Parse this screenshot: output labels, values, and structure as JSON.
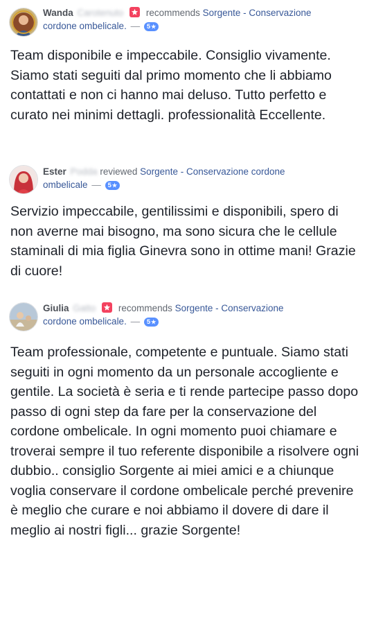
{
  "colors": {
    "link": "#385898",
    "badge": "#5890ff",
    "recommend": "#f3425f",
    "text": "#1d2129"
  },
  "reviews": [
    {
      "first_name": "Wanda",
      "last_name": "Carotenuto",
      "has_recommend_icon": true,
      "action": "recommends",
      "page": "Sorgente - Conservazione cordone ombelicale.",
      "separator": "—",
      "rating": "5",
      "rating_icon": "star-icon",
      "text": "Team disponibile e impeccabile. Consiglio vivamente. Siamo stati seguiti dal primo momento che li abbiamo contattati e non ci hanno mai deluso. Tutto perfetto e curato nei minimi dettagli. professionalità Eccellente."
    },
    {
      "first_name": "Ester",
      "last_name": "Podda",
      "has_recommend_icon": false,
      "action": "reviewed",
      "page": "Sorgente - Conservazione cordone ombelicale",
      "separator": "—",
      "rating": "5",
      "rating_icon": "star-icon",
      "text": "Servizio impeccabile, gentilissimi e disponibili, spero di non averne mai bisogno, ma sono sicura che le cellule staminali di mia figlia Ginevra sono in ottime mani! Grazie di cuore!"
    },
    {
      "first_name": "Giulia",
      "last_name": "Gatto",
      "has_recommend_icon": true,
      "action": "recommends",
      "page": "Sorgente - Conservazione cordone ombelicale.",
      "separator": "—",
      "rating": "5",
      "rating_icon": "star-icon",
      "text": "Team professionale, competente e puntuale. Siamo stati seguiti in ogni momento da un personale accogliente e gentile. La società è seria e ti rende partecipe passo dopo passo di ogni step da fare per la conservazione del cordone ombelicale. In ogni momento puoi chiamare e troverai sempre il tuo referente disponibile a risolvere ogni dubbio.. consiglio Sorgente ai miei amici e a chiunque voglia conservare il cordone ombelicale perché prevenire è meglio che curare e noi abbiamo il dovere di dare il meglio ai nostri figli... grazie Sorgente!"
    }
  ]
}
